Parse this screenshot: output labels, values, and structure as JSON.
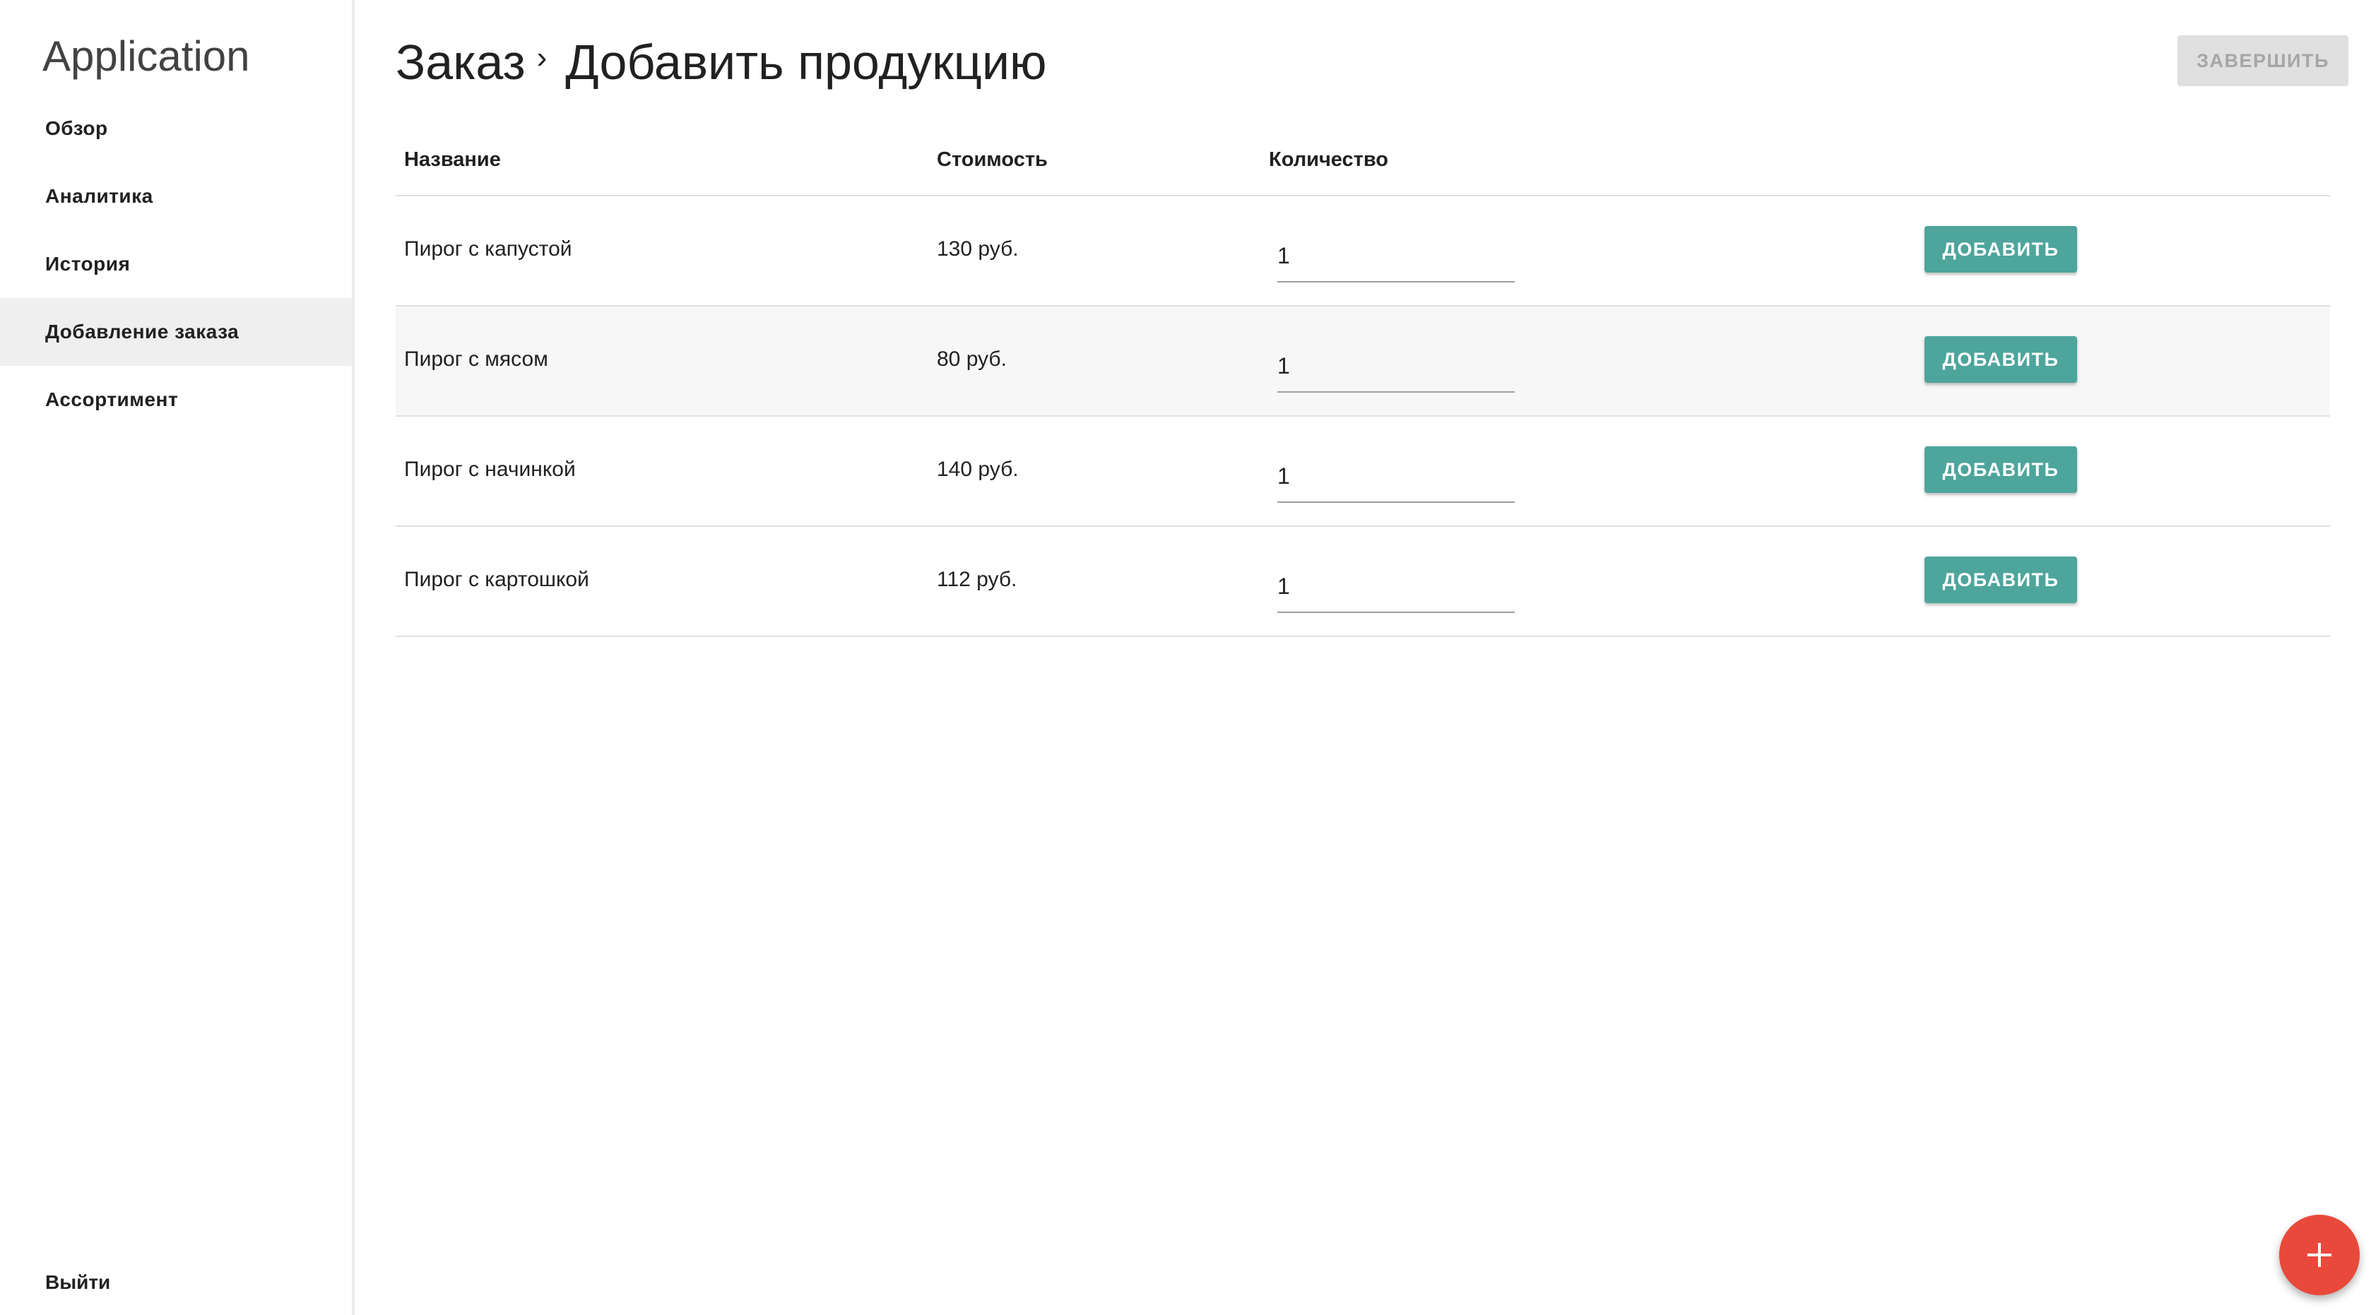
{
  "app": {
    "title": "Application"
  },
  "sidebar": {
    "items": [
      {
        "label": "Обзор",
        "active": false
      },
      {
        "label": "Аналитика",
        "active": false
      },
      {
        "label": "История",
        "active": false
      },
      {
        "label": "Добавление заказа",
        "active": true
      },
      {
        "label": "Ассортимент",
        "active": false
      }
    ],
    "logout_label": "Выйти"
  },
  "header": {
    "breadcrumb_parent": "Заказ",
    "breadcrumb_separator": "›",
    "title": "Добавить продукцию",
    "finish_label": "ЗАВЕРШИТЬ"
  },
  "table": {
    "columns": {
      "name": "Название",
      "cost": "Стоимость",
      "quantity": "Количество"
    },
    "rows": [
      {
        "name": "Пирог с капустой",
        "cost": "130 руб.",
        "quantity": "1",
        "button": "ДОБАВИТЬ"
      },
      {
        "name": "Пирог с мясом",
        "cost": "80 руб.",
        "quantity": "1",
        "button": "ДОБАВИТЬ"
      },
      {
        "name": "Пирог с начинкой",
        "cost": "140 руб.",
        "quantity": "1",
        "button": "ДОБАВИТЬ"
      },
      {
        "name": "Пирог с картошкой",
        "cost": "112 руб.",
        "quantity": "1",
        "button": "ДОБАВИТЬ"
      }
    ]
  },
  "fab": {
    "icon": "plus-icon"
  },
  "colors": {
    "accent": "#4ea59c",
    "fab": "#e9493b",
    "disabled_button": "#e0e0e0",
    "active_nav": "#efefef"
  }
}
